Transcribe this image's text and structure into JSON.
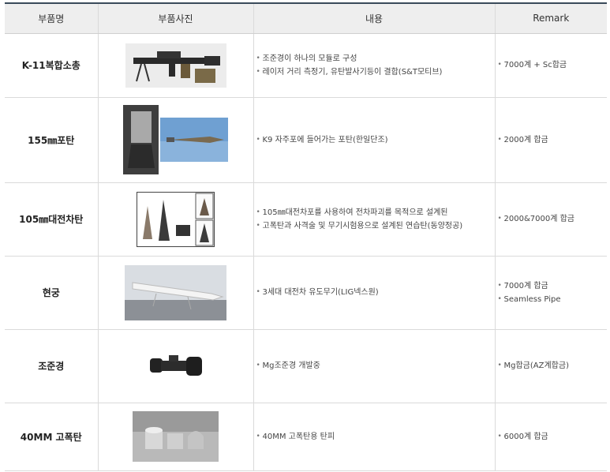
{
  "headers": [
    "부품명",
    "부품사진",
    "내용",
    "Remark"
  ],
  "rows": [
    {
      "name": "K-11복합소총",
      "photo_icon": "rifle-photo",
      "content": [
        "조준경이 하나의 모듈로 구성",
        "레이저 거리 측정기, 유탄발사기등이 결합(S&T모티브)"
      ],
      "remark": [
        "7000계 + Sc합금"
      ]
    },
    {
      "name": "155㎜포탄",
      "photo_icon": "artillery-shell-photo",
      "content": [
        "K9 자주포에 들어가는 포탄(한일단조)"
      ],
      "remark": [
        "2000계 합금"
      ]
    },
    {
      "name": "105㎜대전차탄",
      "photo_icon": "anti-tank-round-photo",
      "content": [
        "105㎜대전차포를 사용하여 전차파괴를 목적으로 설계된",
        "고폭탄과 사격술 및 무기시험용으로 설계된 연습탄(동양정공)"
      ],
      "remark": [
        "2000&7000계 합금"
      ]
    },
    {
      "name": "현궁",
      "photo_icon": "missile-photo",
      "content": [
        "3세대 대전차 유도무기(LIG넥스원)"
      ],
      "remark": [
        "7000계 합금",
        "Seamless Pipe"
      ]
    },
    {
      "name": "조준경",
      "photo_icon": "scope-photo",
      "content": [
        "Mg조준경 개발중"
      ],
      "remark": [
        "Mg합금(AZ계합금)"
      ]
    },
    {
      "name": "40MM 고폭탄",
      "photo_icon": "grenade-shell-photo",
      "content": [
        "40MM 고폭탄용 탄피"
      ],
      "remark": [
        "6000계 합금"
      ]
    }
  ]
}
